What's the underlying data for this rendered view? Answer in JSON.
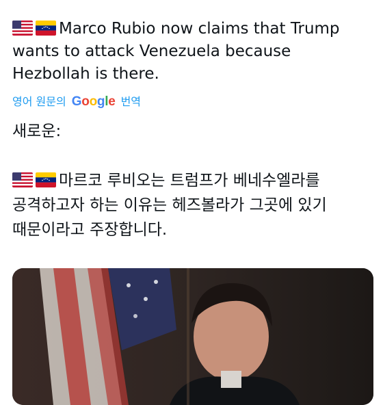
{
  "tweet": {
    "original_text_lines": [
      "Marco Rubio now claims that Trump",
      "wants to attack Venezuela because",
      "Hezbollah is there."
    ],
    "translation_link": {
      "prefix": "영어 원문의",
      "brand": "Google",
      "suffix": "번역"
    },
    "translated_header": "새로운:",
    "translated_text_lines": [
      "마르코 루비오는 트럼프가 베네수엘라를",
      "공격하고자 하는 이유는 헤즈볼라가 그곳에 있기",
      "때문이라고 주장합니다."
    ],
    "flags": [
      "us-flag-icon",
      "venezuela-flag-icon"
    ]
  },
  "colors": {
    "text": "#0f1419",
    "link": "#1d9bf0",
    "google_blue": "#4285f4",
    "google_red": "#ea4335",
    "google_yellow": "#fbbc05",
    "google_green": "#34a853"
  }
}
